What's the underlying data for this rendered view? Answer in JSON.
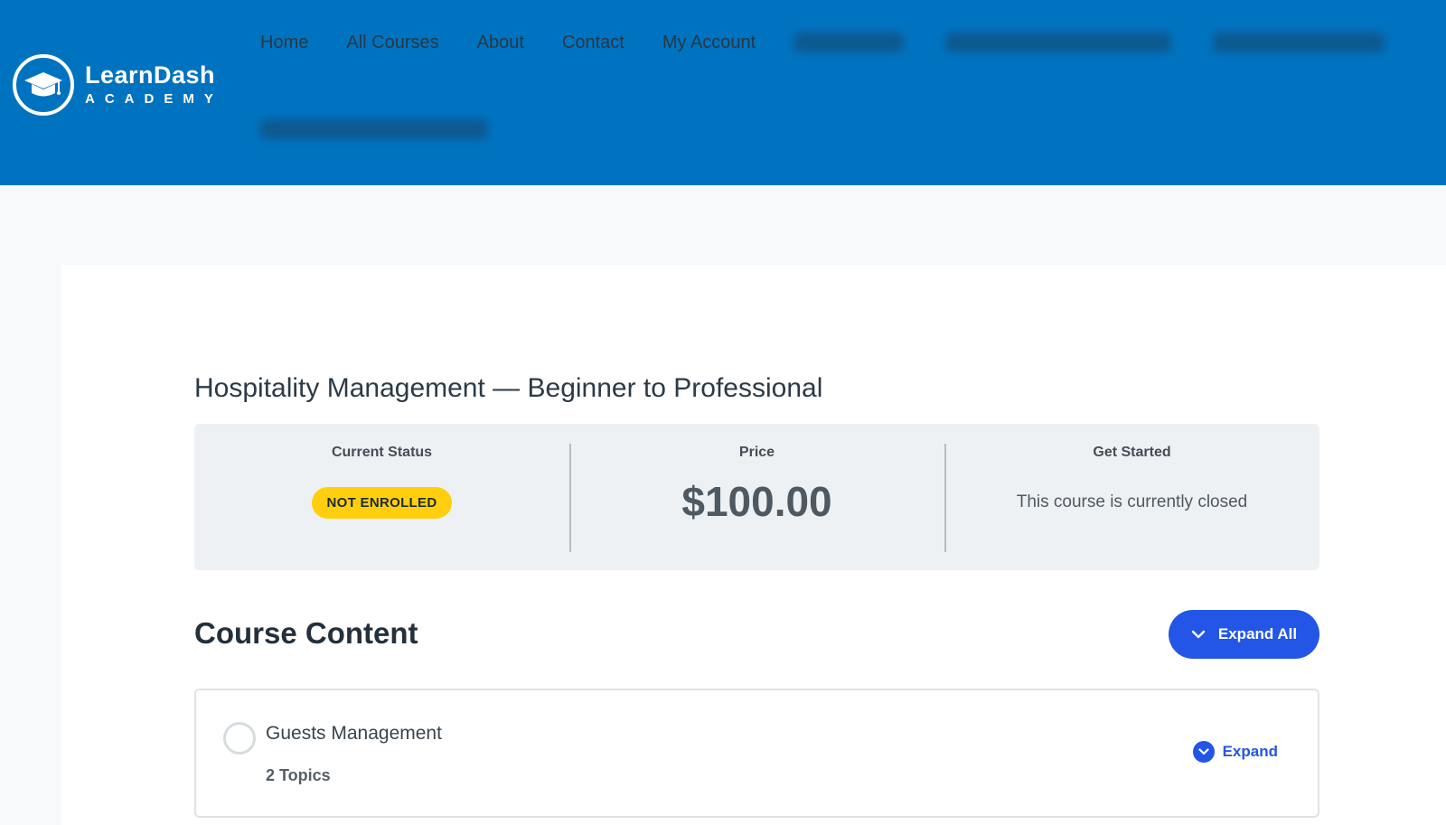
{
  "brand": {
    "name": "LearnDash",
    "sub": "ACADEMY"
  },
  "nav": {
    "items": [
      "Home",
      "All Courses",
      "About",
      "Contact",
      "My Account"
    ]
  },
  "course": {
    "title": "Hospitality Management — Beginner to Professional",
    "status_label": "Current Status",
    "status_value": "NOT ENROLLED",
    "price_label": "Price",
    "price_value": "$100.00",
    "start_label": "Get Started",
    "start_value": "This course is currently closed"
  },
  "content": {
    "heading": "Course Content",
    "expand_all_label": "Expand All",
    "lessons": [
      {
        "title": "Guests Management",
        "topics": "2 Topics",
        "expand_label": "Expand"
      }
    ]
  },
  "colors": {
    "header": "#0073c0",
    "accent": "#2356e6",
    "badge": "#ffcf0f"
  }
}
